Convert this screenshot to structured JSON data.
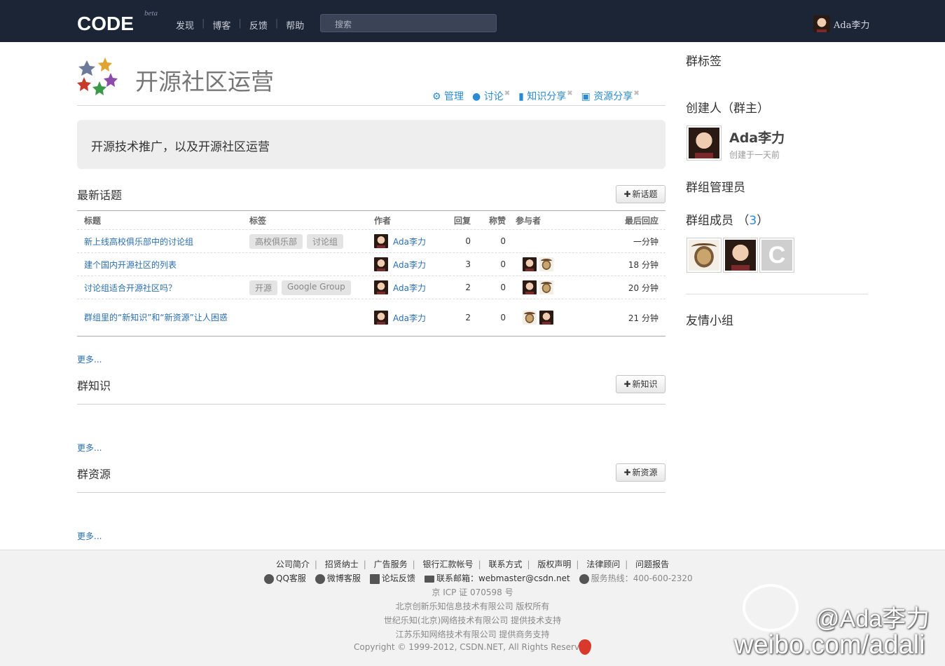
{
  "topbar": {
    "logo": "CODE",
    "logo_tag": "beta",
    "nav": [
      "发现",
      "博客",
      "反馈",
      "帮助"
    ],
    "search_placeholder": "搜索",
    "username": "Ada李力"
  },
  "group": {
    "title": "开源社区运营",
    "tabs": [
      {
        "label": "管理",
        "icon": "gear-icon"
      },
      {
        "label": "讨论",
        "icon": "comments-icon"
      },
      {
        "label": "知识分享",
        "icon": "book-icon"
      },
      {
        "label": "资源分享",
        "icon": "gift-icon"
      }
    ],
    "description": "开源技术推广，以及开源社区运营"
  },
  "topics": {
    "title": "最新话题",
    "new_button": "新话题",
    "columns": [
      "标题",
      "标签",
      "作者",
      "回复",
      "称赞",
      "参与者",
      "最后回应"
    ],
    "rows": [
      {
        "title": "新上线高校俱乐部中的讨论组",
        "tags": [
          "高校俱乐部",
          "讨论组"
        ],
        "author": "Ada李力",
        "replies": "0",
        "likes": "0",
        "participants": [],
        "last": "一分钟"
      },
      {
        "title": "建个国内开源社区的列表",
        "tags": [],
        "author": "Ada李力",
        "replies": "3",
        "likes": "0",
        "participants": [
          "face",
          "gnu"
        ],
        "last": "18 分钟"
      },
      {
        "title": "讨论组适合开源社区吗？",
        "tags": [
          "开源",
          "Google Group"
        ],
        "author": "Ada李力",
        "replies": "2",
        "likes": "0",
        "participants": [
          "face",
          "gnu"
        ],
        "last": "20 分钟"
      },
      {
        "title": "群组里的“新知识”和“新资源”让人困惑",
        "tags": [],
        "author": "Ada李力",
        "replies": "2",
        "likes": "0",
        "participants": [
          "gnu",
          "face"
        ],
        "last": "21 分钟"
      }
    ],
    "more": "更多..."
  },
  "knowledge": {
    "title": "群知识",
    "new_button": "新知识",
    "more": "更多..."
  },
  "resources": {
    "title": "群资源",
    "new_button": "新资源",
    "more": "更多..."
  },
  "sidebar": {
    "tags_title": "群标签",
    "creator_title": "创建人（群主）",
    "creator_name": "Ada李力",
    "creator_sub": "创建于一天前",
    "admins_title": "群组管理员",
    "members_title_prefix": "群组成员 （",
    "members_count": "3",
    "members_title_suffix": "）",
    "friends_title": "友情小组"
  },
  "footer": {
    "links": [
      "公司简介",
      "招贤纳士",
      "广告服务",
      "银行汇款帐号",
      "联系方式",
      "版权声明",
      "法律顾问",
      "问题报告"
    ],
    "qq": "QQ客服",
    "weibo": "微博客服",
    "forum": "论坛反馈",
    "email_label": "联系邮箱：",
    "email": "webmaster@csdn.net",
    "phone_label": "服务热线：",
    "phone": "400-600-2320",
    "icp": "京 ICP 证 070598 号",
    "line1": "北京创新乐知信息技术有限公司 版权所有",
    "line2": "世纪乐知(北京)网络技术有限公司 提供技术支持",
    "line3": "江苏乐知网络技术有限公司 提供商务支持",
    "copyright": "Copyright © 1999-2012, CSDN.NET, All Rights Reserved"
  },
  "watermark": {
    "name": "@Ada李力",
    "url": "weibo.com/adali"
  }
}
